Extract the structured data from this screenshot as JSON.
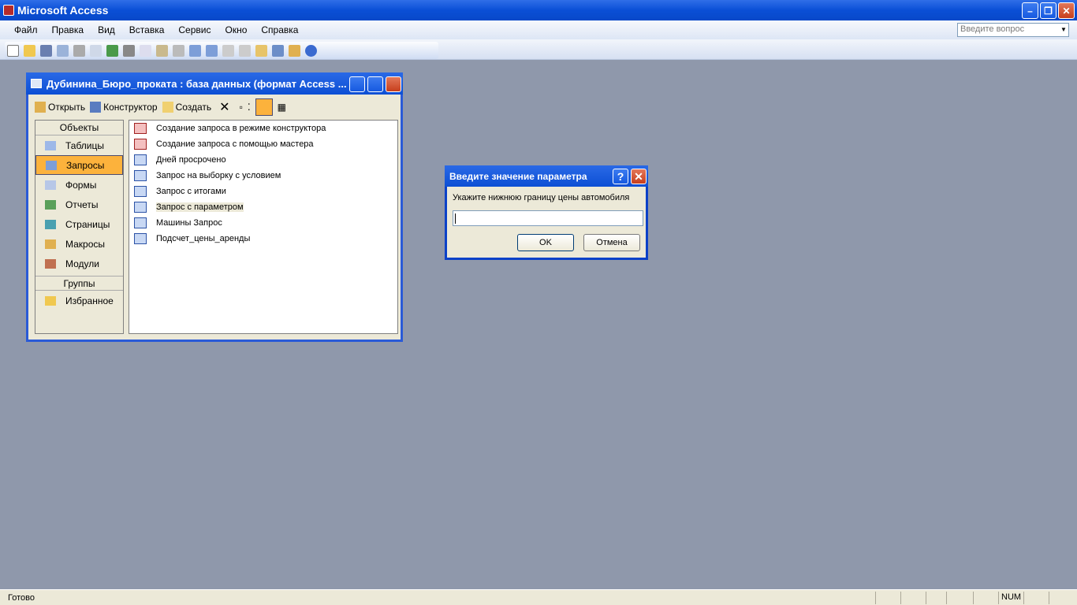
{
  "app": {
    "title": "Microsoft Access"
  },
  "menu": {
    "items": [
      "Файл",
      "Правка",
      "Вид",
      "Вставка",
      "Сервис",
      "Окно",
      "Справка"
    ],
    "help_placeholder": "Введите вопрос"
  },
  "dbwindow": {
    "title": "Дубинина_Бюро_проката : база данных (формат Access ...",
    "toolbar": {
      "open": "Открыть",
      "design": "Конструктор",
      "create": "Создать"
    },
    "objects_header": "Объекты",
    "objects": [
      "Таблицы",
      "Запросы",
      "Формы",
      "Отчеты",
      "Страницы",
      "Макросы",
      "Модули"
    ],
    "selected_object": "Запросы",
    "groups_header": "Группы",
    "groups": [
      "Избранное"
    ],
    "list": [
      "Создание запроса в режиме конструктора",
      "Создание запроса с помощью мастера",
      "Дней просрочено",
      "Запрос на выборку с условием",
      "Запрос с итогами",
      "Запрос с параметром",
      "Машины Запрос",
      "Подсчет_цены_аренды"
    ]
  },
  "dialog": {
    "title": "Введите значение параметра",
    "prompt": "Укажите нижнюю границу цены автомобиля",
    "value": "",
    "ok": "OK",
    "cancel": "Отмена"
  },
  "status": {
    "text": "Готово",
    "num": "NUM"
  }
}
